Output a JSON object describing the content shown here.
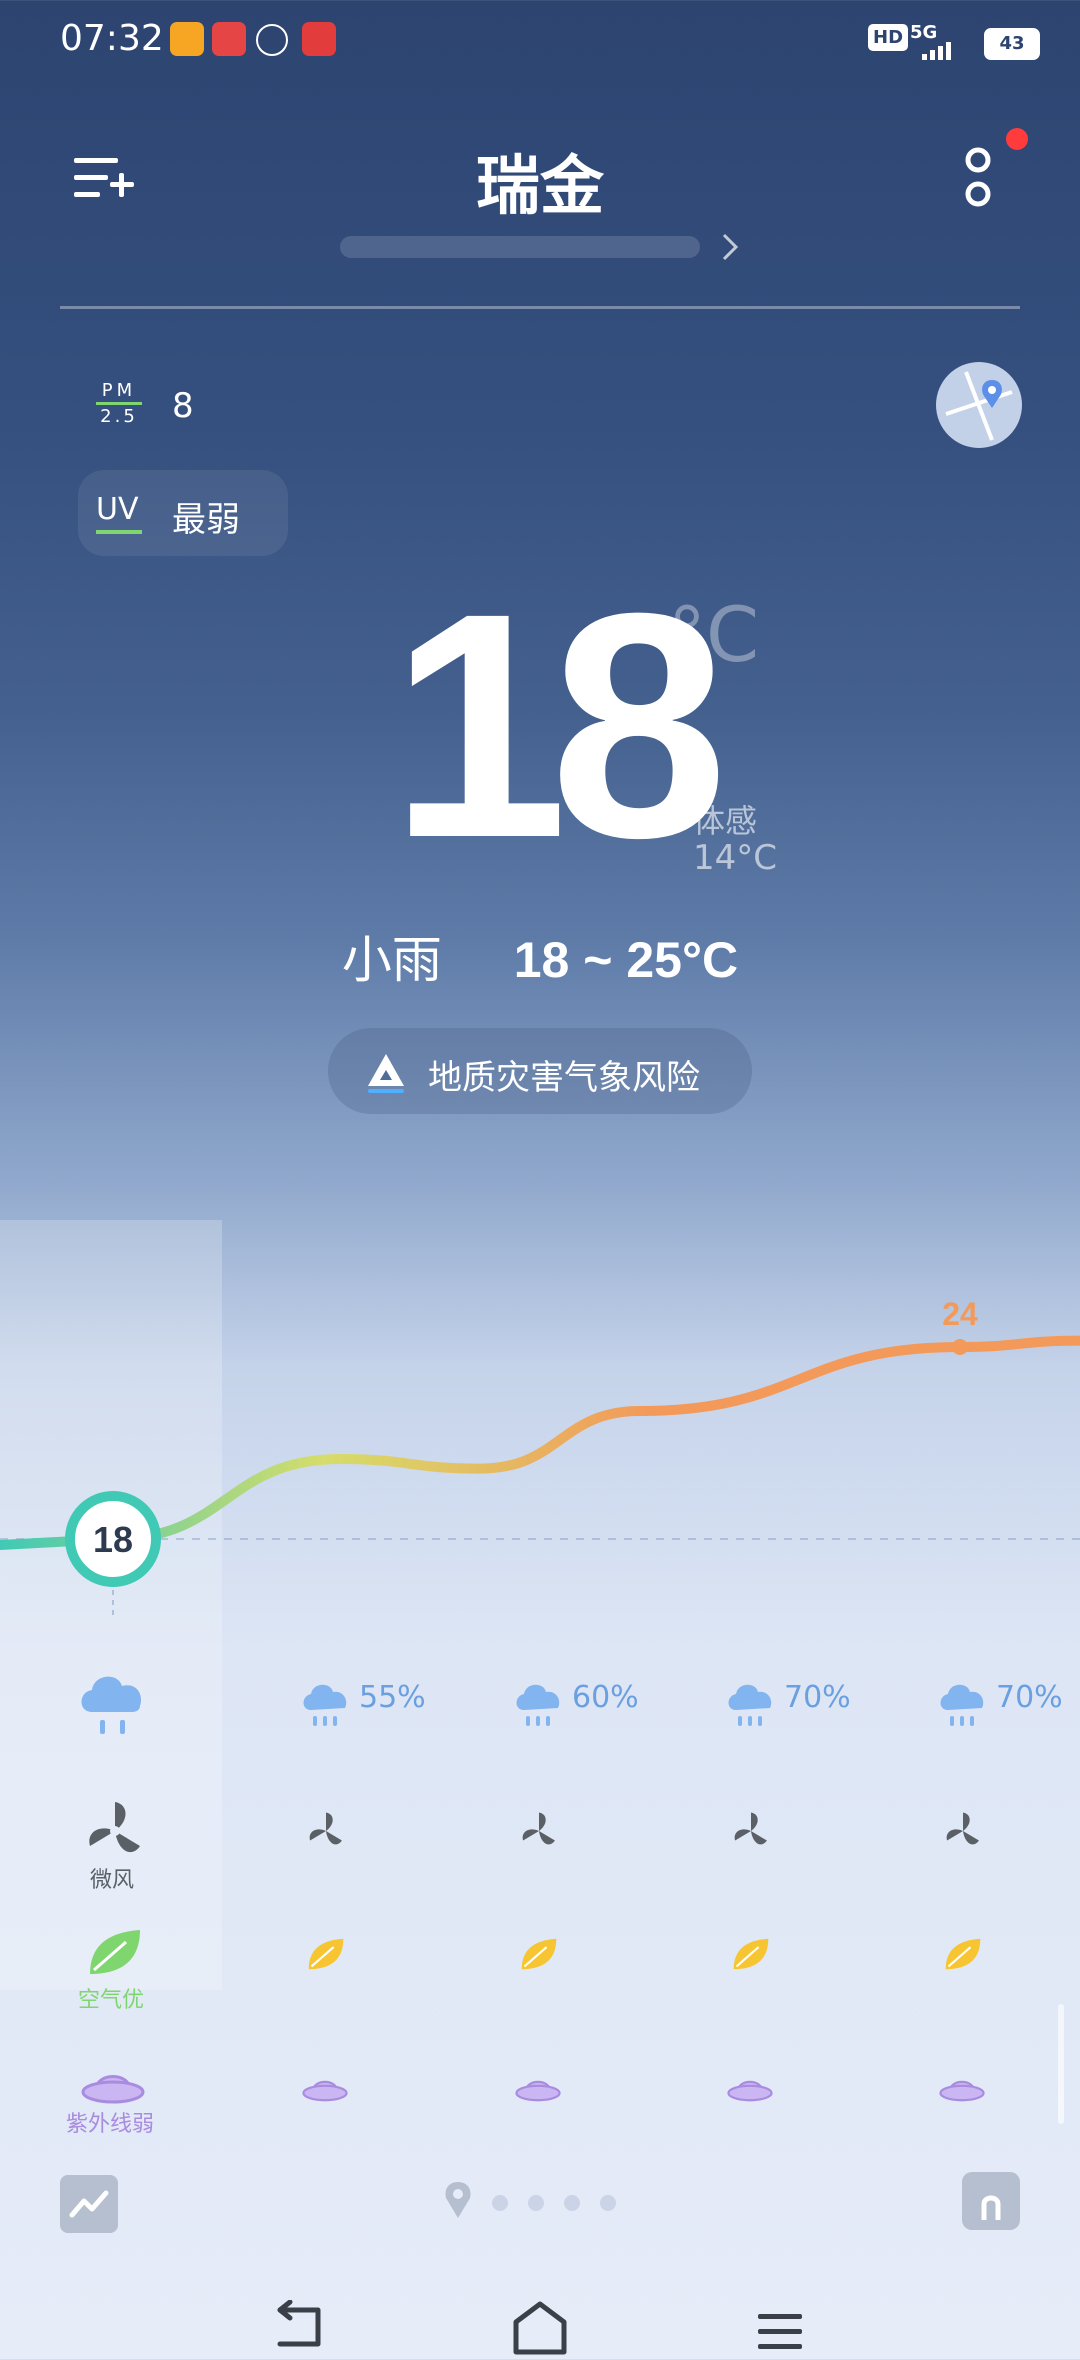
{
  "status": {
    "time": "07:32",
    "hd": "HD",
    "network": "5G",
    "battery": "43"
  },
  "header": {
    "city": "瑞金",
    "menu_icon": "list-add-icon",
    "more_icon": "more-vertical-icon",
    "notification_color": "#ff3b3b"
  },
  "air": {
    "pm_label_top": "PM",
    "pm_label_bottom": "2.5",
    "pm_value": "8",
    "uv_label": "UV",
    "uv_value": "最弱"
  },
  "current": {
    "temperature": "18",
    "unit": "°C",
    "feels_label": "体感",
    "feels_value": "14°C",
    "condition": "小雨",
    "range": "18 ~ 25°C"
  },
  "warning": {
    "text": "地质灾害气象风险"
  },
  "chart_data": {
    "type": "line",
    "series": [
      {
        "values": [
          18,
          20.5,
          20.2,
          22,
          24,
          24.2
        ]
      }
    ],
    "labels": {
      "start": "18",
      "peak": "24"
    },
    "colors": {
      "start": "#40c9b5",
      "mid": "#d6dd6a",
      "end": "#f39a5a"
    }
  },
  "forecast": {
    "precip": [
      "",
      "55%",
      "60%",
      "70%",
      "70%"
    ],
    "wind_label": "微风",
    "air_label": "空气优",
    "uv_label": "紫外线弱",
    "colors": {
      "air": "#7fd66f",
      "uv": "#a98be0",
      "leaf": "#f7c531",
      "wind": "#5b5f66"
    }
  },
  "bottom": {
    "trend_icon": "trend-icon",
    "home_icon": "home-icon",
    "pages": 5
  }
}
